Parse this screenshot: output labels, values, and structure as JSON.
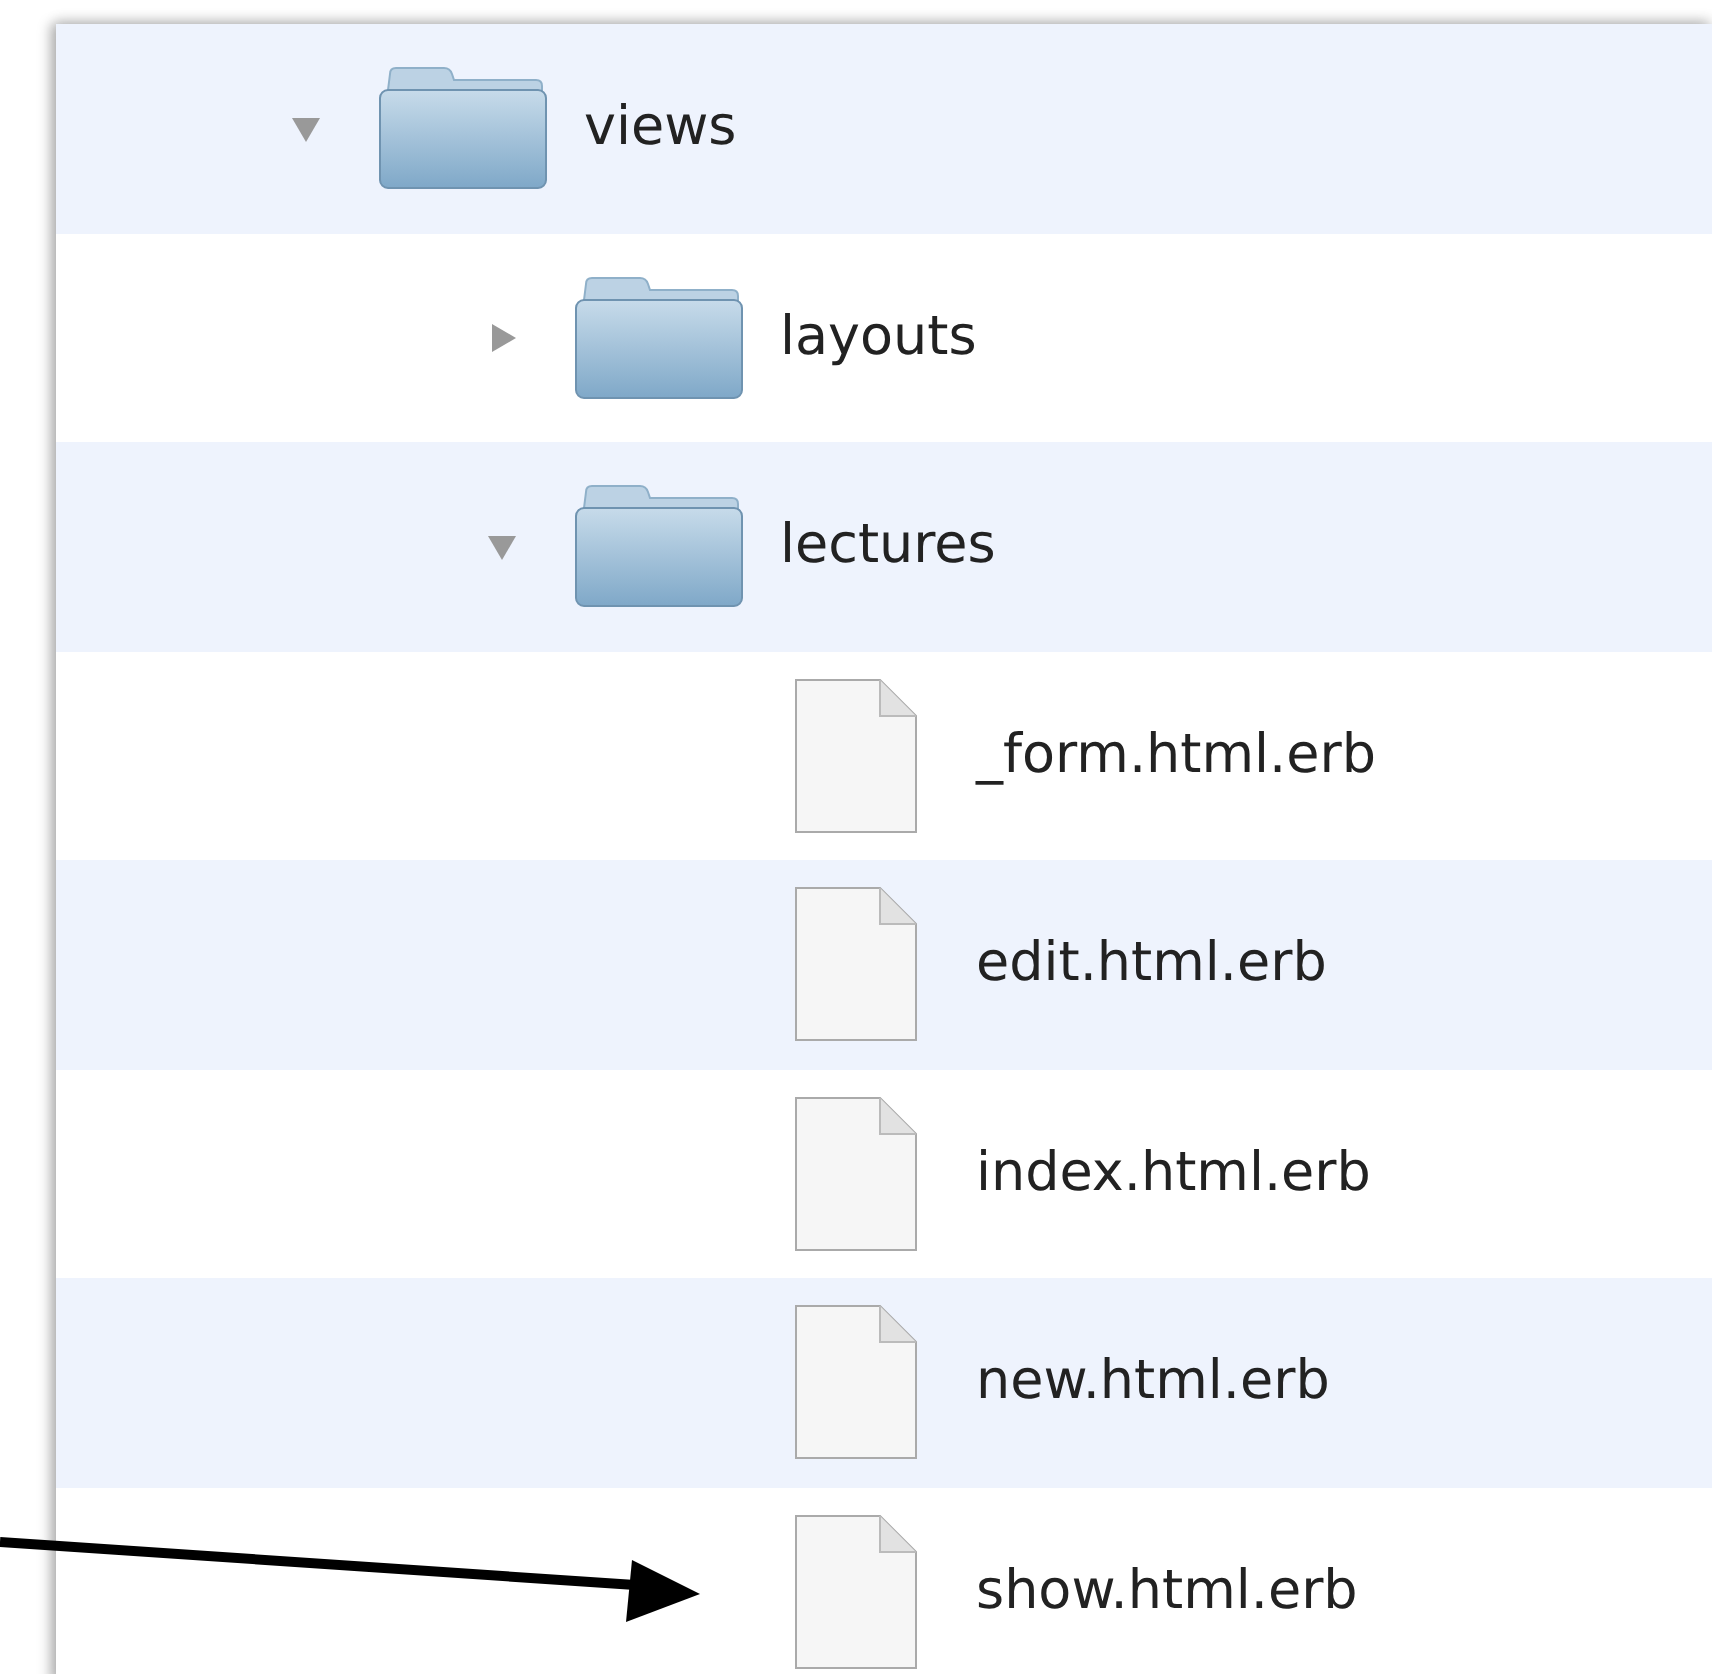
{
  "tree": [
    {
      "kind": "folder",
      "name": "views",
      "expanded": true,
      "children": [
        {
          "kind": "folder",
          "name": "layouts",
          "expanded": false
        },
        {
          "kind": "folder",
          "name": "lectures",
          "expanded": true,
          "children": [
            {
              "kind": "file",
              "name": "_form.html.erb"
            },
            {
              "kind": "file",
              "name": "edit.html.erb"
            },
            {
              "kind": "file",
              "name": "index.html.erb"
            },
            {
              "kind": "file",
              "name": "new.html.erb"
            },
            {
              "kind": "file",
              "name": "show.html.erb"
            }
          ]
        }
      ]
    }
  ]
}
